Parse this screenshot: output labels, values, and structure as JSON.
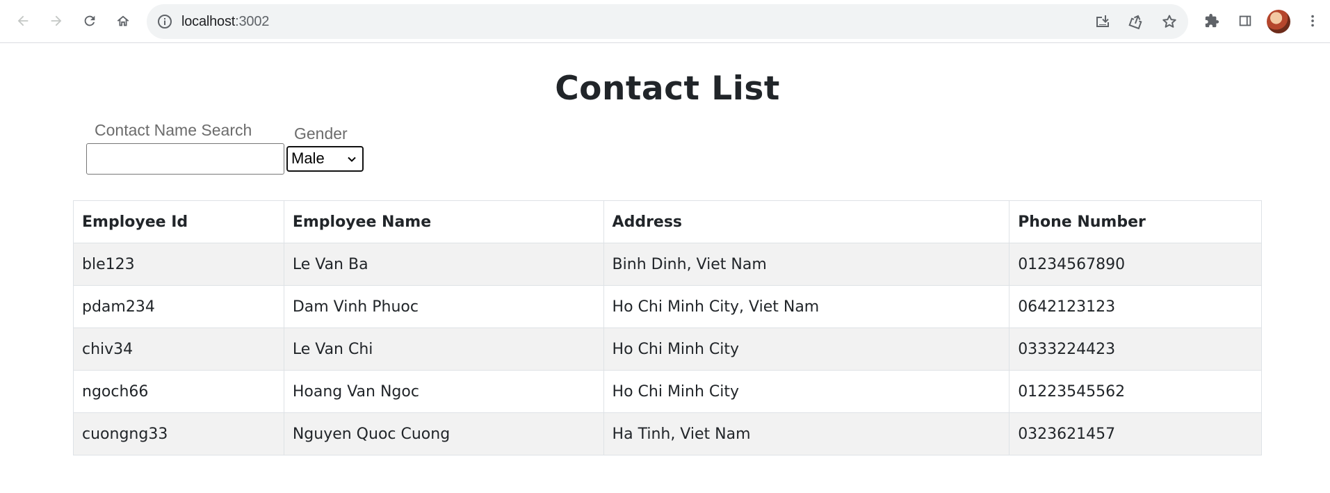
{
  "browser": {
    "url_host": "localhost",
    "url_port": ":3002",
    "icons": {
      "back": "arrow-left-icon",
      "forward": "arrow-right-icon",
      "reload": "reload-icon",
      "home": "home-icon",
      "site_info": "info-icon",
      "install": "install-app-icon",
      "share": "share-icon",
      "bookmark": "star-icon",
      "extensions": "puzzle-icon",
      "side_panel": "side-panel-icon",
      "menu": "kebab-menu-icon"
    }
  },
  "page": {
    "title": "Contact List",
    "search": {
      "label": "Contact Name Search",
      "value": "",
      "placeholder": ""
    },
    "gender": {
      "label": "Gender",
      "selected": "Male"
    }
  },
  "table": {
    "headers": [
      "Employee Id",
      "Employee Name",
      "Address",
      "Phone Number"
    ],
    "rows": [
      [
        "ble123",
        "Le Van Ba",
        "Binh Dinh, Viet Nam",
        "01234567890"
      ],
      [
        "pdam234",
        "Dam Vinh Phuoc",
        "Ho Chi Minh City, Viet Nam",
        "0642123123"
      ],
      [
        "chiv34",
        "Le Van Chi",
        "Ho Chi Minh City",
        "0333224423"
      ],
      [
        "ngoch66",
        "Hoang Van Ngoc",
        "Ho Chi Minh City",
        "01223545562"
      ],
      [
        "cuongng33",
        "Nguyen Quoc Cuong",
        "Ha Tinh, Viet Nam",
        "0323621457"
      ]
    ]
  },
  "colors": {
    "stripe": "#f2f2f2",
    "border": "#dee2e6",
    "toolbar_bg": "#ffffff",
    "omnibox_bg": "#f1f3f4"
  }
}
